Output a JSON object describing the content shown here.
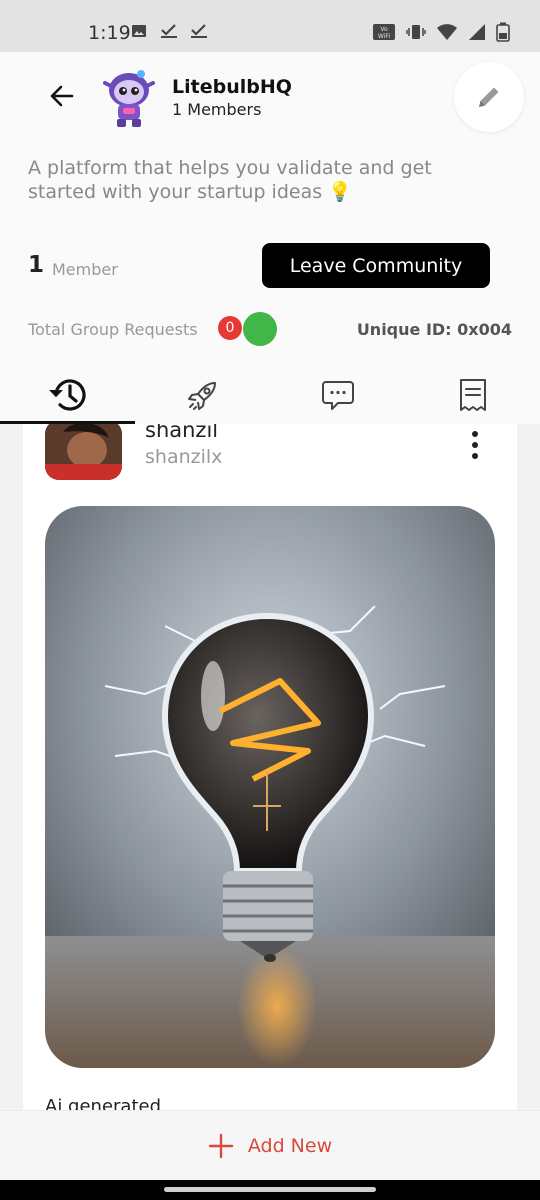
{
  "status_bar": {
    "time": "1:19"
  },
  "header": {
    "title": "LitebulbHQ",
    "members_subtitle": "1 Members",
    "description": "A platform that helps you validate and get started with your startup ideas 💡",
    "member_count": "1",
    "member_label": "Member",
    "leave_button": "Leave Community",
    "requests_label": "Total Group Requests",
    "requests_count": "0",
    "unique_id": "Unique ID: 0x004"
  },
  "tabs": [
    {
      "name": "history-icon",
      "active": true
    },
    {
      "name": "rocket-icon",
      "active": false
    },
    {
      "name": "chat-bubble-icon",
      "active": false
    },
    {
      "name": "receipt-icon",
      "active": false
    }
  ],
  "post": {
    "author_name": "shanzil",
    "author_handle": "shanzilx",
    "caption": "Ai generated"
  },
  "bottom": {
    "add_label": "Add New"
  },
  "colors": {
    "accent": "#d84b3c",
    "badge_red": "#e53935",
    "badge_green": "#43b649"
  }
}
